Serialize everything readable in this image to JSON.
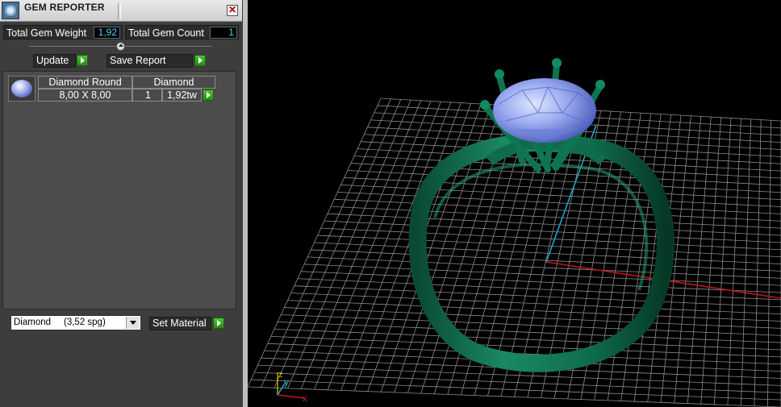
{
  "window": {
    "title": "GEM REPORTER",
    "close_label": "✕",
    "app_icon": "gem-reporter-icon"
  },
  "stats": {
    "weight_label": "Total Gem Weight",
    "weight_value": "1,92",
    "count_label": "Total Gem Count",
    "count_value": "1"
  },
  "actions": {
    "update_label": "Update",
    "save_report_label": "Save Report",
    "set_material_label": "Set Material"
  },
  "gem_list": {
    "headers": [
      "Diamond Round",
      "Diamond"
    ],
    "rows": [
      {
        "size": "8,00 X 8,00",
        "count": "1",
        "weight": "1,92tw",
        "thumb_icon": "round-diamond-icon"
      }
    ]
  },
  "material_select": {
    "value": "Diamond     (3,52 spg)"
  },
  "viewport": {
    "axis_labels": {
      "z": "z",
      "y": "y",
      "x": "x"
    }
  },
  "colors": {
    "accent_value": "#4fd0ff",
    "go_button": "#3aa321",
    "ring": "#0f6b4c",
    "gem": "#8fa0e6",
    "x_axis": "#c81414",
    "y_axis": "#1fa6c8"
  }
}
